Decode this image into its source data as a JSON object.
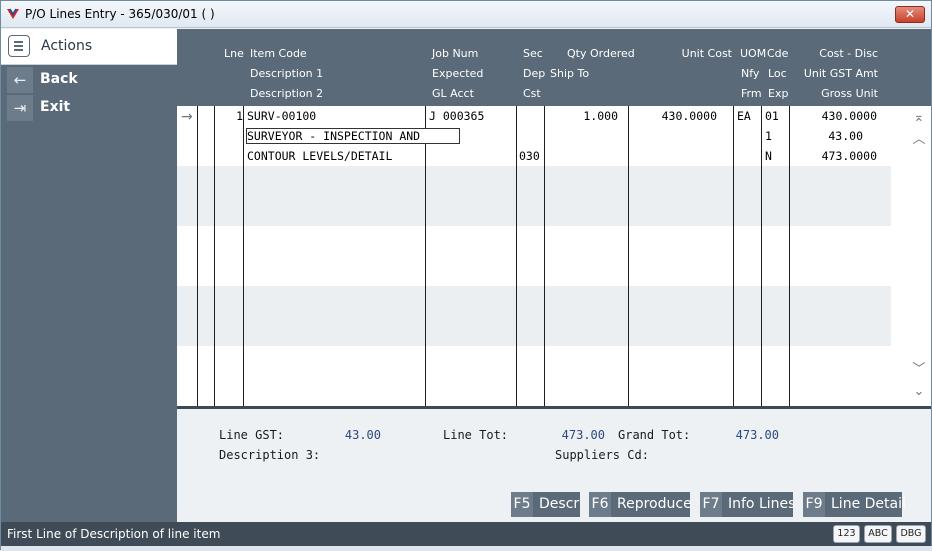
{
  "window": {
    "title": "P/O Lines Entry - 365/030/01      (    )",
    "close_label": "✕"
  },
  "sidebar": {
    "actions_label": "Actions",
    "items": [
      {
        "label": "Back",
        "icon": "back-arrow-icon",
        "glyph": "←"
      },
      {
        "label": "Exit",
        "icon": "exit-icon",
        "glyph": "⇥"
      }
    ]
  },
  "grid": {
    "headers": {
      "lne": "Lne",
      "item_code": "Item Code",
      "description1": "Description 1",
      "description2": "Description 2",
      "job_num": "Job Num",
      "expected": "Expected",
      "gl_acct": "GL Acct",
      "sec": "Sec",
      "dep": "Dep",
      "cst": "Cst",
      "qty_ordered": "Qty Ordered",
      "ship_to": "Ship To",
      "unit_cost": "Unit Cost",
      "uom": "UOM",
      "nfy": "Nfy",
      "frm": "Frm",
      "cde": "Cde",
      "loc": "Loc",
      "exp": "Exp",
      "cost_disc": "Cost - Disc",
      "unit_gst_amt": "Unit GST Amt",
      "gross_unit": "Gross Unit"
    },
    "row": {
      "line_no": "1",
      "item_code": "SURV-00100",
      "description1": "SURVEYOR - INSPECTION AND",
      "description2": "CONTOUR LEVELS/DETAIL",
      "job_num": "J 000365",
      "cst": "030",
      "qty_ordered": "1.000",
      "unit_cost": "430.0000",
      "uom": "EA",
      "cde": "01",
      "loc": "1",
      "exp": "N",
      "cost_disc": "430.0000",
      "unit_gst_amt": "43.00",
      "gross_unit": "473.0000"
    }
  },
  "totals": {
    "line_gst_label": "Line GST:",
    "line_gst": "43.00",
    "line_tot_label": "Line Tot:",
    "line_tot": "473.00",
    "grand_tot_label": "Grand Tot:",
    "grand_tot": "473.00",
    "description3_label": "Description 3:",
    "suppliers_cd_label": "Suppliers Cd:"
  },
  "function_keys": [
    {
      "key": "F5",
      "label": "Descr"
    },
    {
      "key": "F6",
      "label": "Reproduce"
    },
    {
      "key": "F7",
      "label": "Info Lines"
    },
    {
      "key": "F9",
      "label": "Line Detail"
    }
  ],
  "status": {
    "text": "First Line of Description of line item",
    "badges": [
      "123",
      "ABC",
      "DBG"
    ]
  },
  "colors": {
    "sidebar": "#5a6a79",
    "header": "#5a6a79",
    "status_bar": "#3f4b57",
    "total_value": "#2a4a7e"
  }
}
